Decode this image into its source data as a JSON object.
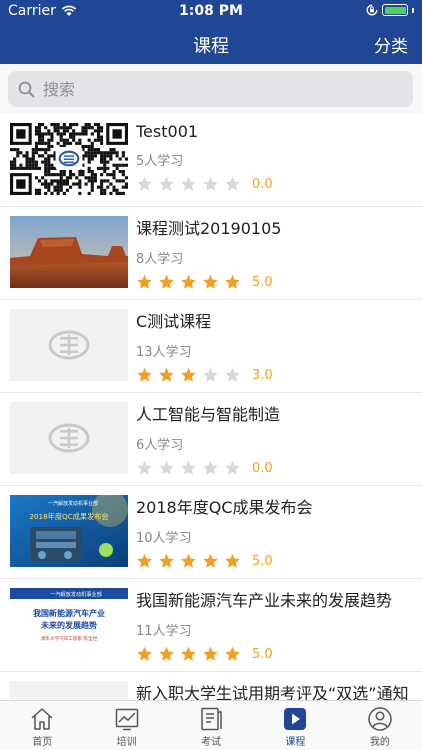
{
  "status": {
    "carrier": "Carrier",
    "time": "1:08 PM"
  },
  "nav": {
    "title": "课程",
    "right_label": "分类"
  },
  "search": {
    "placeholder": "搜索"
  },
  "courses": [
    {
      "name": "Test001",
      "learners": "5人学习",
      "rating": 0,
      "score": "0.0",
      "thumb": "qr-code"
    },
    {
      "name": "课程测试20190105",
      "learners": "8人学习",
      "rating": 5,
      "score": "5.0",
      "thumb": "desert-landscape"
    },
    {
      "name": "C测试课程",
      "learners": "13人学习",
      "rating": 3,
      "score": "3.0",
      "thumb": "placeholder-logo"
    },
    {
      "name": "人工智能与智能制造",
      "learners": "6人学习",
      "rating": 0,
      "score": "0.0",
      "thumb": "placeholder-logo"
    },
    {
      "name": "2018年度QC成果发布会",
      "learners": "10人学习",
      "rating": 5,
      "score": "5.0",
      "thumb": "engine-banner"
    },
    {
      "name": "我国新能源汽车产业未来的发展趋势",
      "learners": "11人学习",
      "rating": 5,
      "score": "5.0",
      "thumb": "slide-cover"
    },
    {
      "name": "新入职大学生试用期考评及“双选”通知",
      "learners": "",
      "rating": 0,
      "score": "",
      "thumb": "placeholder-logo"
    }
  ],
  "thumb_text": {
    "banner_top": "一汽解放发动机事业部",
    "banner_title": "2018年度QC成果发布会",
    "slide_top": "一汽解放发动机事业部",
    "slide_title": "我国新能源汽车产业\n未来的发展趋势",
    "slide_author": "清华大学汽车工程系  陈全世"
  },
  "tabs": [
    {
      "label": "首页",
      "icon": "home-icon",
      "active": false
    },
    {
      "label": "培训",
      "icon": "chart-icon",
      "active": false
    },
    {
      "label": "考试",
      "icon": "document-icon",
      "active": false
    },
    {
      "label": "课程",
      "icon": "play-icon",
      "active": true
    },
    {
      "label": "我的",
      "icon": "profile-icon",
      "active": false
    }
  ],
  "colors": {
    "brand": "#1f4796",
    "star_on": "#f2a01f",
    "star_off": "#d8d8d8"
  }
}
